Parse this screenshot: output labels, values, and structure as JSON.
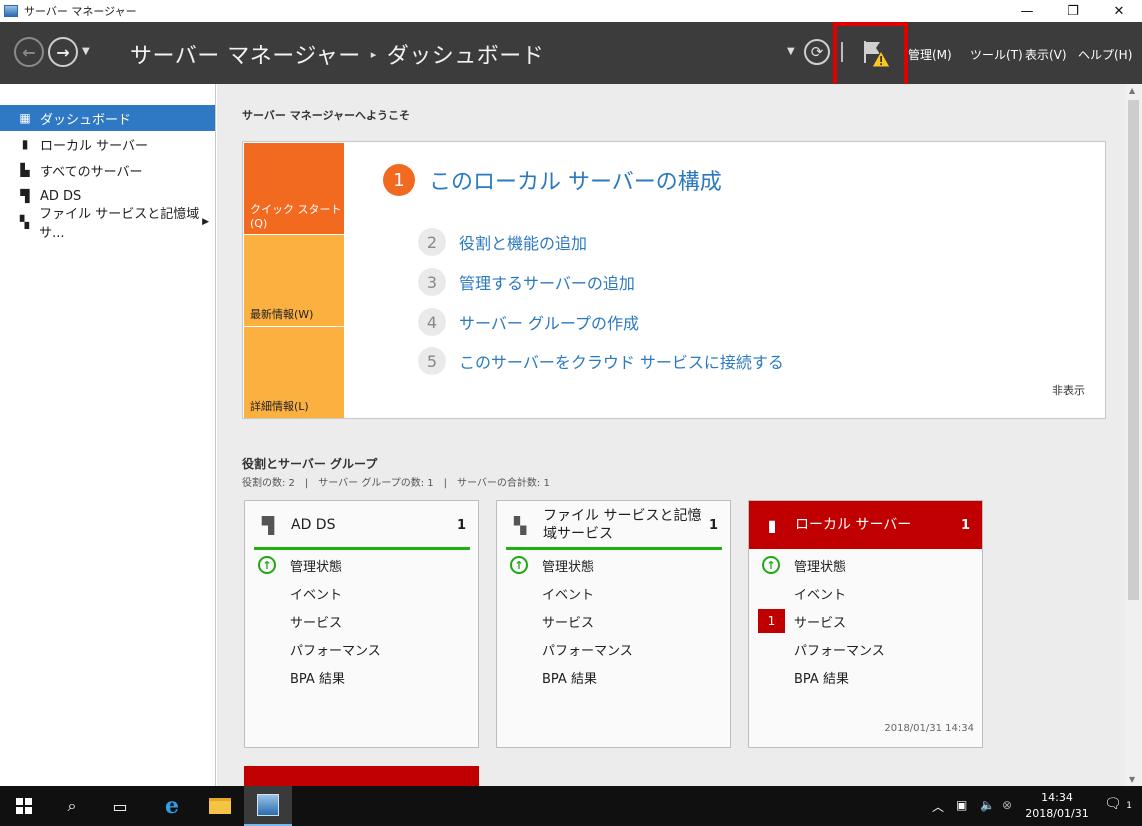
{
  "window": {
    "title": "サーバー マネージャー",
    "controls": [
      "—",
      "❐",
      "✕"
    ]
  },
  "header": {
    "breadcrumb_root": "サーバー マネージャー",
    "breadcrumb_sep": "▸",
    "breadcrumb_current": "ダッシュボード",
    "menus": [
      "管理(M)",
      "ツール(T)",
      "表示(V)",
      "ヘルプ(H)"
    ],
    "notification_state": "warning"
  },
  "sidebar": {
    "items": [
      {
        "label": "ダッシュボード",
        "icon": "dashboard-icon",
        "active": true
      },
      {
        "label": "ローカル サーバー",
        "icon": "server-icon"
      },
      {
        "label": "すべてのサーバー",
        "icon": "servers-icon"
      },
      {
        "label": "AD DS",
        "icon": "adds-icon"
      },
      {
        "label": "ファイル サービスと記憶域サ...",
        "icon": "file-services-icon",
        "has_arrow": true
      }
    ]
  },
  "main": {
    "welcome": "サーバー マネージャーへようこそ",
    "quickstart": {
      "tabs": [
        "クイック スタート(Q)",
        "最新情報(W)",
        "詳細情報(L)"
      ],
      "step1": {
        "num": "1",
        "label": "このローカル サーバーの構成"
      },
      "steps": [
        {
          "num": "2",
          "label": "役割と機能の追加"
        },
        {
          "num": "3",
          "label": "管理するサーバーの追加"
        },
        {
          "num": "4",
          "label": "サーバー グループの作成"
        },
        {
          "num": "5",
          "label": "このサーバーをクラウド サービスに接続する"
        }
      ],
      "hide": "非表示"
    },
    "roles": {
      "title": "役割とサーバー グループ",
      "summary": "役割の数: 2　|　サーバー グループの数: 1　|　サーバーの合計数: 1"
    },
    "tiles": [
      {
        "name": "AD DS",
        "count": "1",
        "rows": [
          "管理状態",
          "イベント",
          "サービス",
          "パフォーマンス",
          "BPA 結果"
        ]
      },
      {
        "name": "ファイル サービスと記憶域サービス",
        "count": "1",
        "rows": [
          "管理状態",
          "イベント",
          "サービス",
          "パフォーマンス",
          "BPA 結果"
        ]
      },
      {
        "name": "ローカル サーバー",
        "count": "1",
        "rows": [
          "管理状態",
          "イベント",
          "サービス",
          "パフォーマンス",
          "BPA 結果"
        ],
        "service_badge": "1",
        "timestamp": "2018/01/31 14:34"
      }
    ]
  },
  "taskbar": {
    "time": "14:34",
    "date": "2018/01/31",
    "notifications": "1"
  }
}
